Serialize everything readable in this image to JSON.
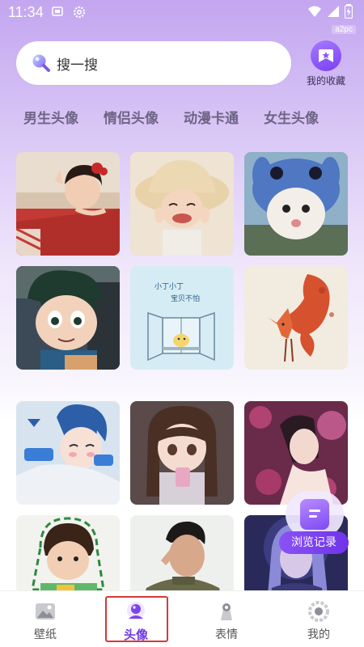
{
  "status_bar": {
    "time": "11:34",
    "badge": "a2pc"
  },
  "search": {
    "placeholder": "搜一搜"
  },
  "favorites": {
    "label": "我的收藏"
  },
  "categories": [
    "男生头像",
    "情侣头像",
    "动漫卡通",
    "女生头像"
  ],
  "tiles": [
    {
      "label": ""
    },
    {
      "label": ""
    },
    {
      "label": ""
    },
    {
      "label": ""
    },
    {
      "label": "小丁小丁 宝贝不怕",
      "lines": [
        "小丁小丁",
        "宝贝不怕"
      ]
    },
    {
      "label": ""
    },
    {
      "label": ""
    },
    {
      "label": ""
    },
    {
      "label": ""
    },
    {
      "label": ""
    },
    {
      "label": ""
    },
    {
      "label": ""
    }
  ],
  "history": {
    "label": "浏览记录"
  },
  "bottom_nav": {
    "items": [
      {
        "label": "壁纸",
        "icon": "image-icon"
      },
      {
        "label": "头像",
        "icon": "avatar-icon"
      },
      {
        "label": "表情",
        "icon": "emoji-icon"
      },
      {
        "label": "我的",
        "icon": "profile-icon"
      }
    ],
    "active": "头像"
  },
  "colors": {
    "accent": "#6f3ae6",
    "highlight": "#d43a3a"
  }
}
